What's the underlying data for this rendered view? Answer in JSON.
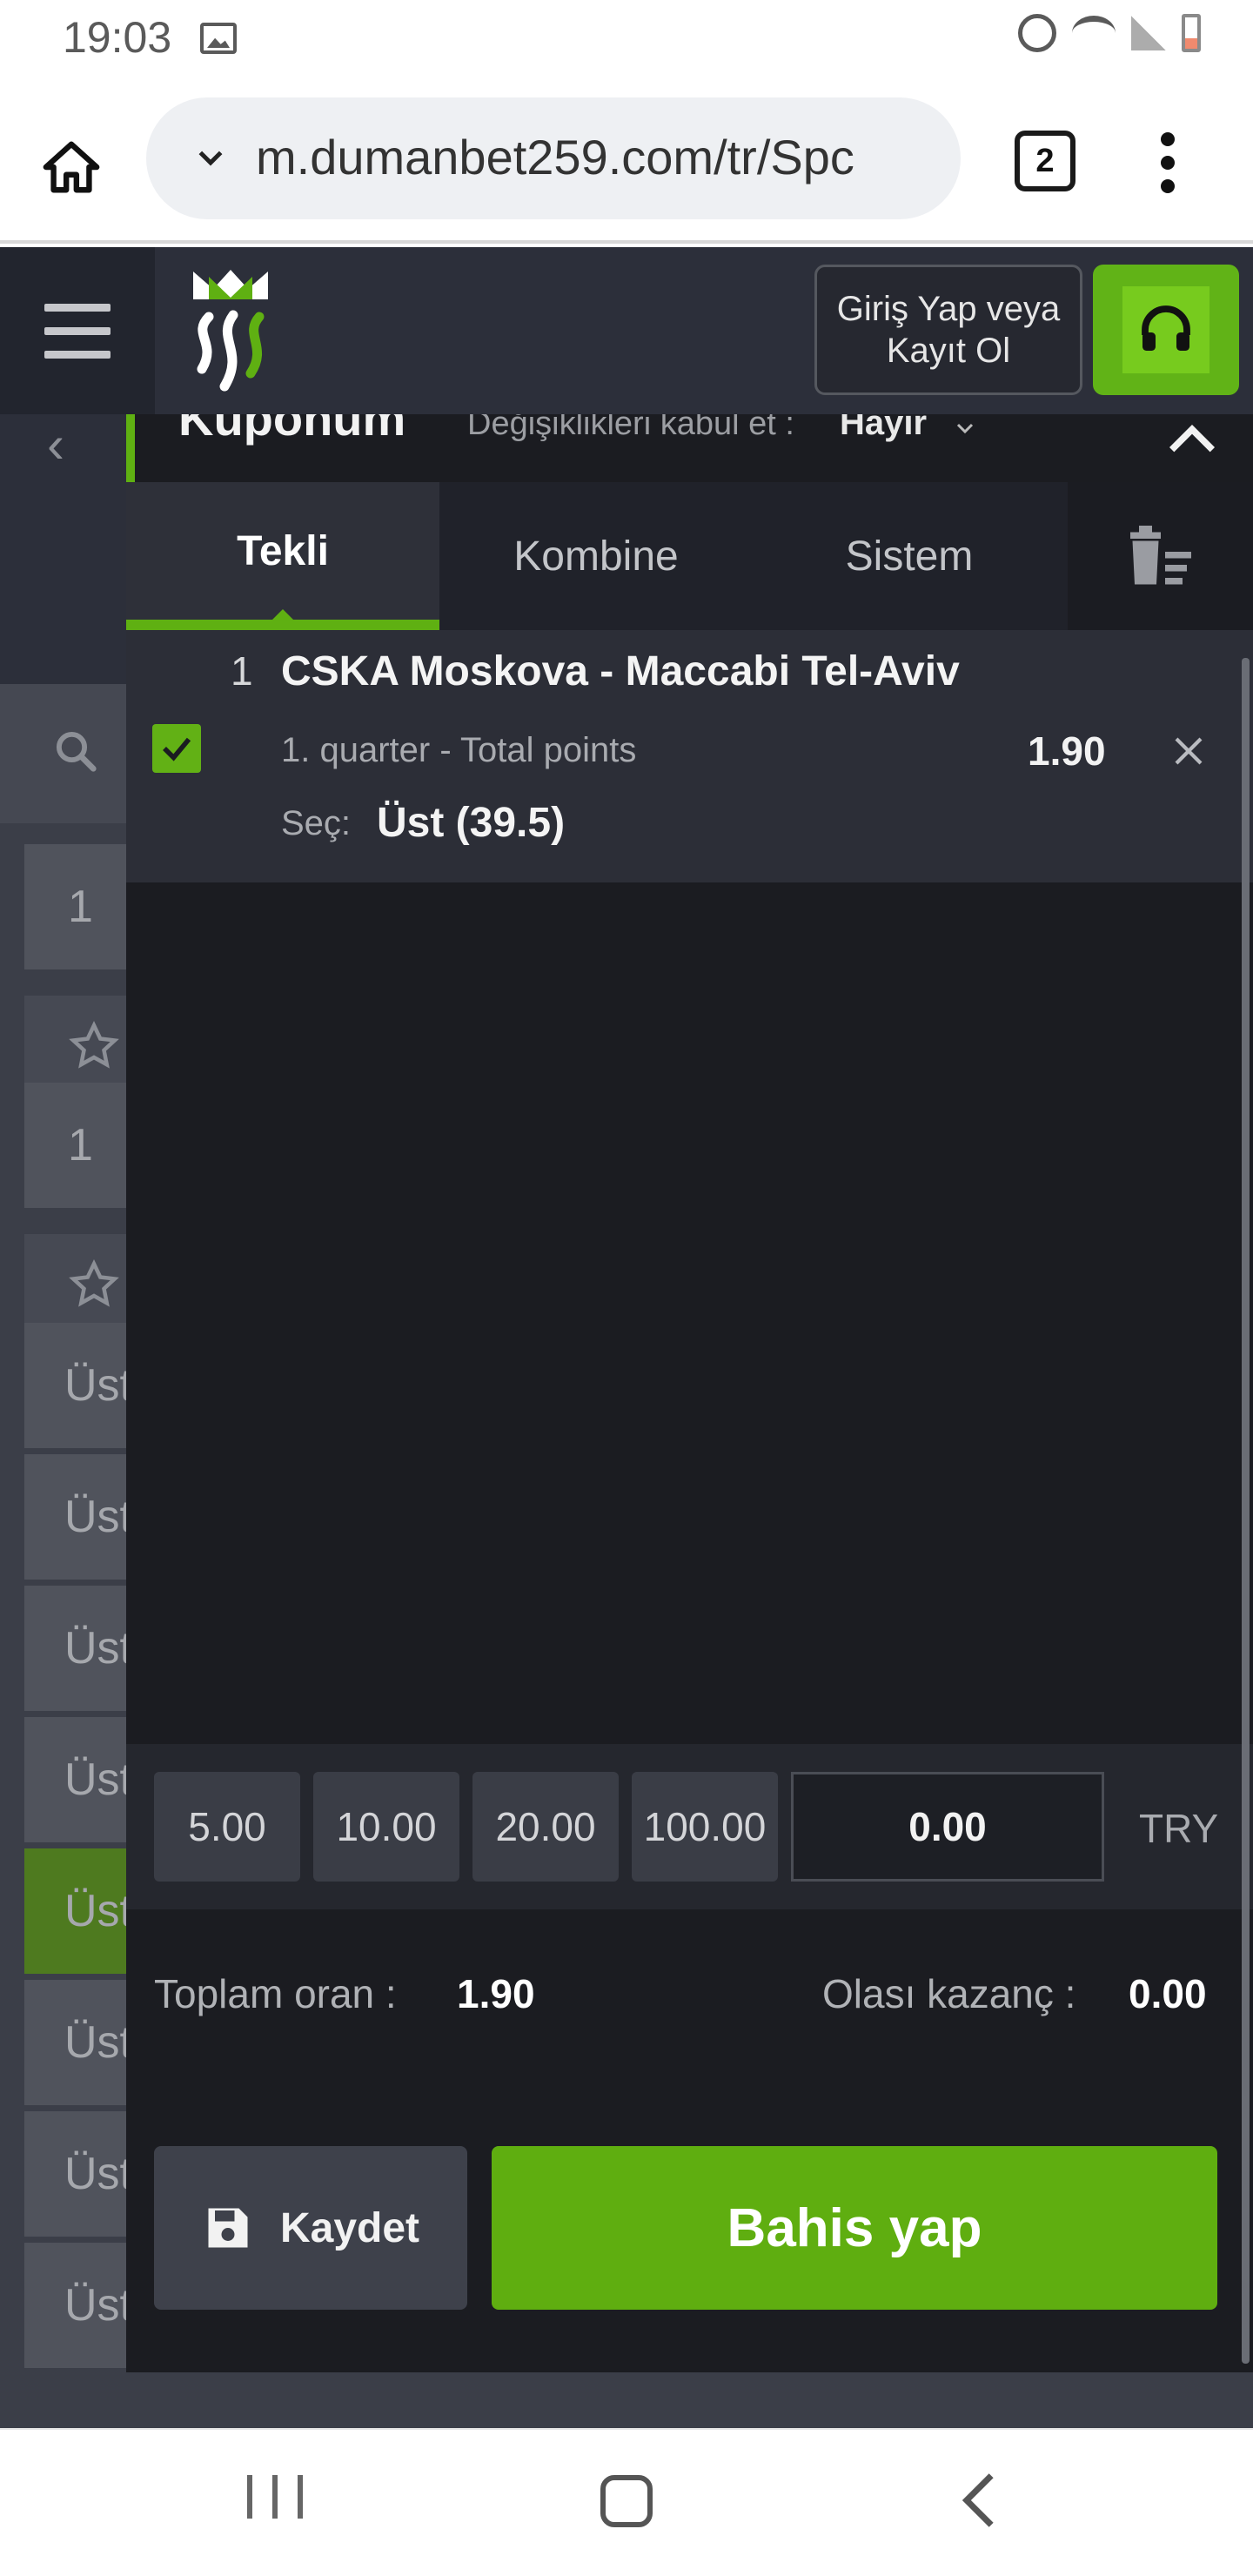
{
  "statusbar": {
    "time": "19:03"
  },
  "browser": {
    "url": "m.dumanbet259.com/tr/Spc",
    "tab_count": "2"
  },
  "header": {
    "login_label": "Giriş Yap veya Kayıt Ol"
  },
  "background": {
    "tiles": [
      "1",
      "1",
      "Üst",
      "Üst",
      "Üst",
      "Üst",
      "Üst",
      "Üst",
      "Üst",
      "Üst"
    ]
  },
  "coupon": {
    "title": "Kuponum",
    "accept_changes_label": "Değişiklikleri kabul et :",
    "accept_changes_value": "Hayır",
    "tabs": [
      {
        "label": "Tekli",
        "active": true
      },
      {
        "label": "Kombine",
        "active": false
      },
      {
        "label": "Sistem",
        "active": false
      }
    ],
    "bet": {
      "index": "1",
      "event": "CSKA Moskova - Maccabi Tel-Aviv",
      "market": "1. quarter - Total points",
      "odds": "1.90",
      "selection_label": "Seç:",
      "selection": "Üst (39.5)"
    },
    "stake_presets": [
      "5.00",
      "10.00",
      "20.00",
      "100.00"
    ],
    "stake_value": "0.00",
    "currency": "TRY",
    "total_odds_label": "Toplam oran :",
    "total_odds": "1.90",
    "possible_win_label": "Olası kazanç :",
    "possible_win": "0.00",
    "save_label": "Kaydet",
    "place_bet_label": "Bahis yap"
  },
  "colors": {
    "accent": "#5fae10",
    "modal_bg": "#1b1c21",
    "header_bg": "#2c2f3a"
  }
}
